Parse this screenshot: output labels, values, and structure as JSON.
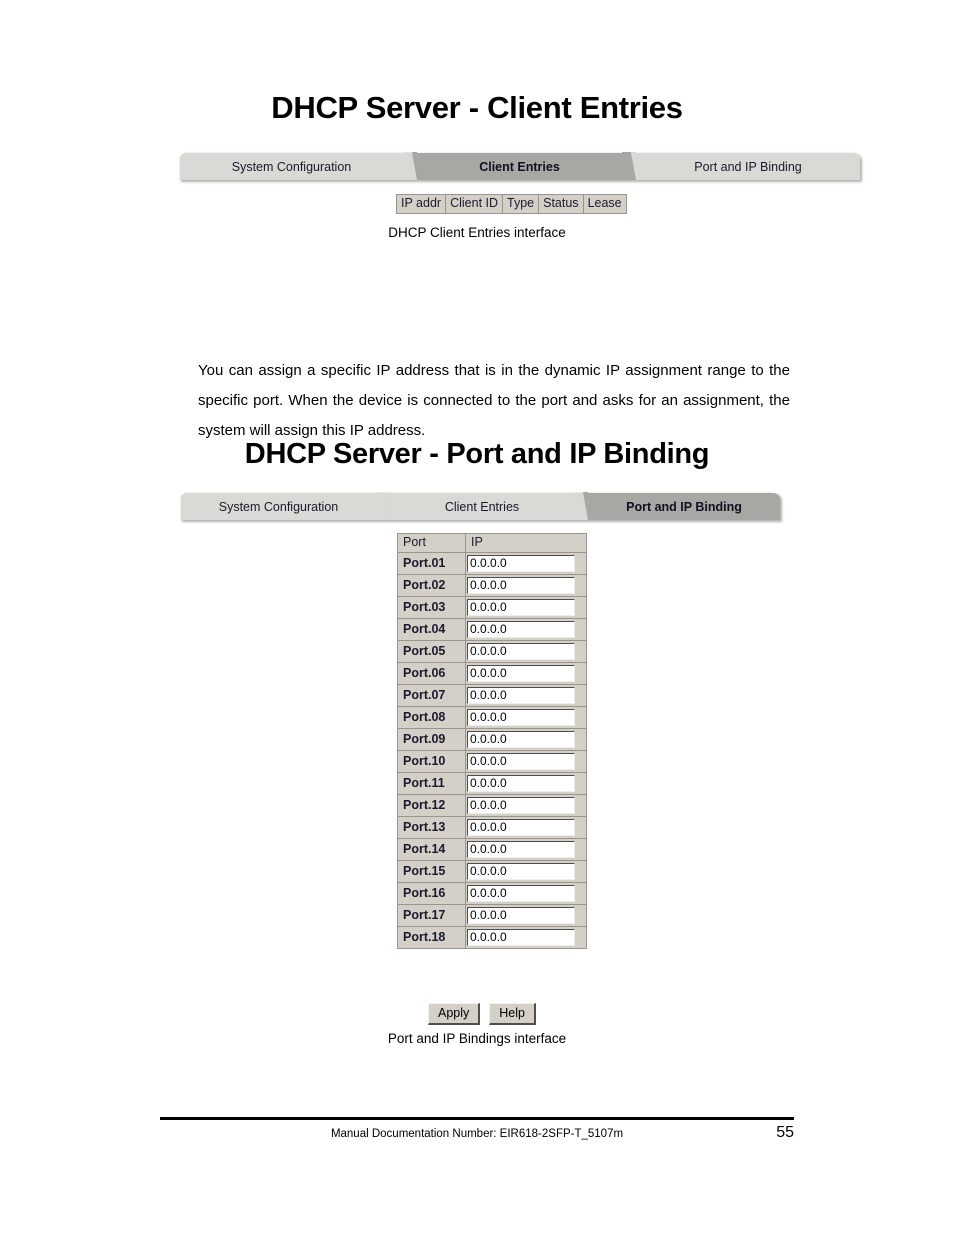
{
  "page": {
    "section1": {
      "title": "DHCP Server - Client Entries",
      "caption": "DHCP Client Entries interface",
      "tabs": [
        {
          "label": "System Configuration",
          "active": false
        },
        {
          "label": "Client Entries",
          "active": true
        },
        {
          "label": "Port and IP Binding",
          "active": false
        }
      ],
      "client_entries_columns": [
        "IP addr",
        "Client ID",
        "Type",
        "Status",
        "Lease"
      ]
    },
    "paragraph": "You can assign a specific IP address that is in the dynamic IP assignment range to the specific port. When the device is connected to the port and asks for an assignment, the system will assign this IP address.",
    "section2": {
      "title": "DHCP Server - Port and IP Binding",
      "caption": "Port and IP Bindings interface",
      "tabs": [
        {
          "label": "System Configuration",
          "active": false
        },
        {
          "label": "Client Entries",
          "active": false
        },
        {
          "label": "Port and IP Binding",
          "active": true
        }
      ],
      "table": {
        "headers": [
          "Port",
          "IP"
        ],
        "rows": [
          {
            "port": "Port.01",
            "ip": "0.0.0.0"
          },
          {
            "port": "Port.02",
            "ip": "0.0.0.0"
          },
          {
            "port": "Port.03",
            "ip": "0.0.0.0"
          },
          {
            "port": "Port.04",
            "ip": "0.0.0.0"
          },
          {
            "port": "Port.05",
            "ip": "0.0.0.0"
          },
          {
            "port": "Port.06",
            "ip": "0.0.0.0"
          },
          {
            "port": "Port.07",
            "ip": "0.0.0.0"
          },
          {
            "port": "Port.08",
            "ip": "0.0.0.0"
          },
          {
            "port": "Port.09",
            "ip": "0.0.0.0"
          },
          {
            "port": "Port.10",
            "ip": "0.0.0.0"
          },
          {
            "port": "Port.11",
            "ip": "0.0.0.0"
          },
          {
            "port": "Port.12",
            "ip": "0.0.0.0"
          },
          {
            "port": "Port.13",
            "ip": "0.0.0.0"
          },
          {
            "port": "Port.14",
            "ip": "0.0.0.0"
          },
          {
            "port": "Port.15",
            "ip": "0.0.0.0"
          },
          {
            "port": "Port.16",
            "ip": "0.0.0.0"
          },
          {
            "port": "Port.17",
            "ip": "0.0.0.0"
          },
          {
            "port": "Port.18",
            "ip": "0.0.0.0"
          }
        ]
      },
      "buttons": {
        "apply": "Apply",
        "help": "Help"
      }
    },
    "footer": {
      "note": "Manual Documentation Number: EIR618-2SFP-T_5107m",
      "page_number": "55"
    }
  },
  "colors": {
    "tab_inactive": "#d9d9d5",
    "tab_active": "#a7a7a3",
    "table_bg": "#d4d0c8",
    "table_border": "#9a968f",
    "text": "#1a1a2e"
  }
}
